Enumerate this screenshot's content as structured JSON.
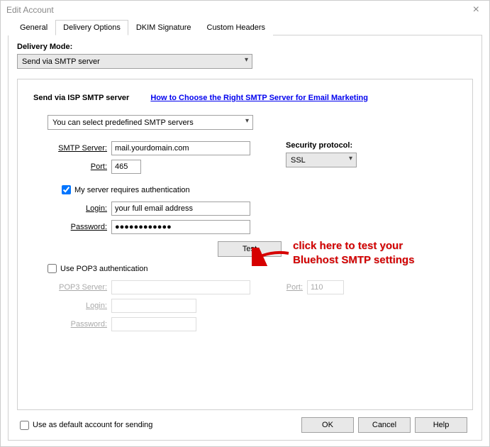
{
  "window": {
    "title": "Edit Account"
  },
  "tabs": {
    "general": "General",
    "delivery": "Delivery Options",
    "dkim": "DKIM Signature",
    "custom": "Custom Headers"
  },
  "delivery": {
    "mode_label": "Delivery Mode:",
    "mode_value": "Send via SMTP server",
    "panel_title": "Send via ISP SMTP server",
    "help_link": "How to Choose the Right SMTP Server for Email Marketing",
    "predefined_value": "You can select predefined SMTP servers",
    "smtp_server_label": "SMTP Server:",
    "smtp_server_value": "mail.yourdomain.com",
    "port_label": "Port:",
    "port_value": "465",
    "security_label": "Security protocol:",
    "security_value": "SSL",
    "auth_checkbox_label": "My server requires authentication",
    "login_label": "Login:",
    "login_value": "your full email address",
    "password_label": "Password:",
    "password_value": "●●●●●●●●●●●●",
    "test_button": "Test",
    "pop3_checkbox_label": "Use POP3 authentication",
    "pop3_server_label": "POP3 Server:",
    "pop3_server_value": "",
    "pop3_port_label": "Port:",
    "pop3_port_value": "110",
    "pop3_login_label": "Login:",
    "pop3_login_value": "",
    "pop3_password_label": "Password:",
    "pop3_password_value": ""
  },
  "annotation": {
    "line1": "click here to test your",
    "line2": "Bluehost SMTP settings"
  },
  "footer": {
    "default_label": "Use as default account for sending",
    "ok": "OK",
    "cancel": "Cancel",
    "help": "Help"
  }
}
